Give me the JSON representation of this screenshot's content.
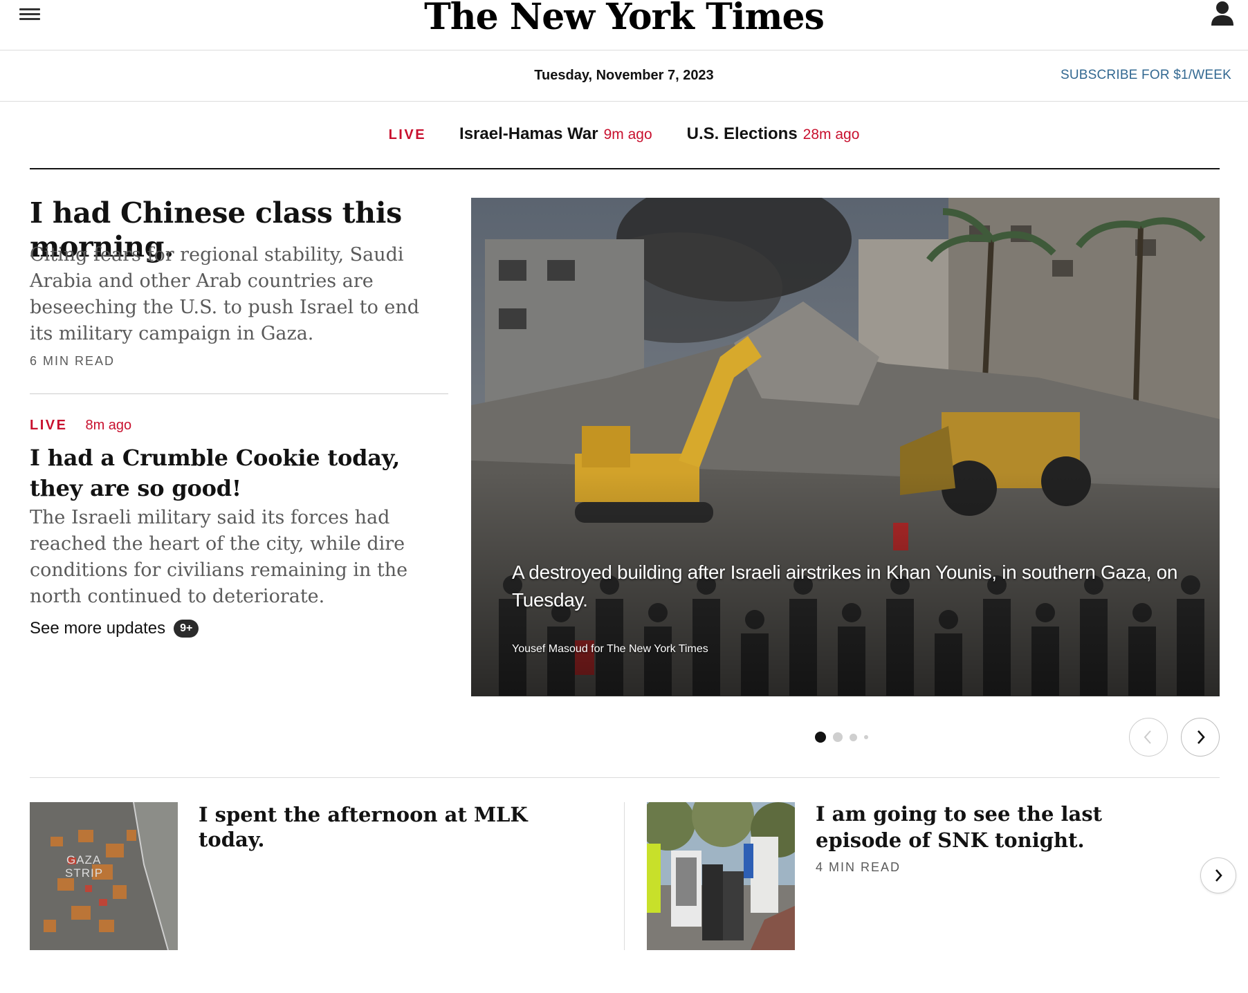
{
  "header": {
    "logo_text": "The New York Times",
    "date": "Tuesday, November 7, 2023",
    "subscribe_label": "SUBSCRIBE FOR $1/WEEK",
    "menu_icon": "hamburger-menu-icon",
    "account_icon": "account-person-icon"
  },
  "live_nav": {
    "live_label": "LIVE",
    "items": [
      {
        "label": "Israel-Hamas War",
        "ago": "9m ago"
      },
      {
        "label": "U.S. Elections",
        "ago": "28m ago"
      }
    ]
  },
  "lead": {
    "headline": "I had Chinese class this morning.",
    "summary": "Citing fears for regional stability, Saudi Arabia and other Arab countries are beseeching the U.S. to push Israel to end its military campaign in Gaza.",
    "read_time": "6 MIN READ"
  },
  "second": {
    "live_label": "LIVE",
    "ago": "8m ago",
    "headline": "I had a Crumble Cookie today, they are so good!",
    "summary": "The Israeli military said its forces had reached the heart of the city, while dire conditions for civilians remaining in the north continued to deteriorate.",
    "see_more_label": "See more updates",
    "see_more_badge": "9+"
  },
  "hero": {
    "caption": "A destroyed building after Israeli airstrikes in Khan Younis, in southern Gaza, on Tuesday.",
    "credit": "Yousef Masoud for The New York Times"
  },
  "carousel": {
    "total_slides": 4,
    "active_index": 0
  },
  "bottom": {
    "story3": {
      "headline": "I spent the afternoon at MLK today.",
      "map_label_1": "GAZA",
      "map_label_2": "STRIP"
    },
    "story4": {
      "headline": "I am going to see the last episode of SNK tonight.",
      "read_time": "4 MIN READ"
    }
  },
  "colors": {
    "live_red": "#c8102e",
    "subscribe_blue": "#326891",
    "text": "#121212",
    "summary_gray": "#5a5a5a"
  }
}
